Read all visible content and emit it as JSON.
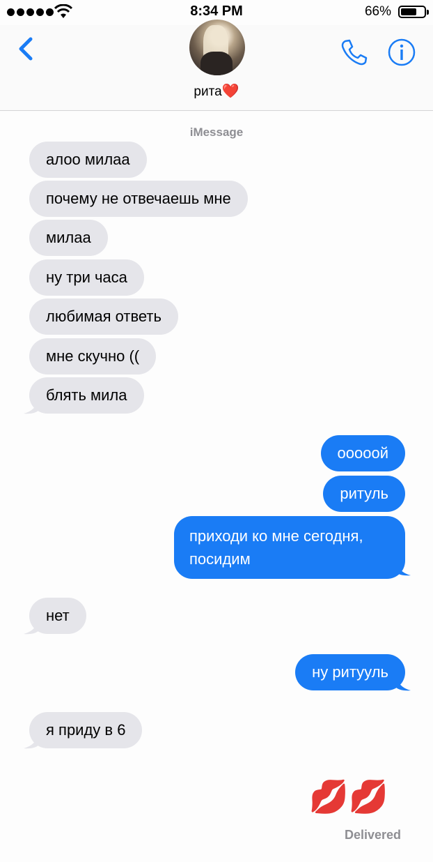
{
  "status_bar": {
    "time": "8:34 PM",
    "battery_percent": "66%",
    "battery_level": 0.66,
    "signal_dots": 5
  },
  "header": {
    "contact_name": "рита",
    "contact_emoji": "❤️",
    "back_icon": "chevron-left-icon",
    "call_icon": "phone-icon",
    "info_icon": "info-icon"
  },
  "conversation": {
    "service_label": "iMessage",
    "messages": [
      {
        "from": "them",
        "text": "алоо милаа"
      },
      {
        "from": "them",
        "text": "почему не отвечаешь мне"
      },
      {
        "from": "them",
        "text": "милаа"
      },
      {
        "from": "them",
        "text": "ну три часа"
      },
      {
        "from": "them",
        "text": "любимая ответь"
      },
      {
        "from": "them",
        "text": "мне скучно (("
      },
      {
        "from": "them",
        "text": "блять мила"
      },
      {
        "from": "me",
        "text": "oooooй"
      },
      {
        "from": "me",
        "text": "ритуль"
      },
      {
        "from": "me",
        "text": "приходи ко мне сегодня, посидим"
      },
      {
        "from": "them",
        "text": "нет"
      },
      {
        "from": "me",
        "text": "ну ритууль"
      },
      {
        "from": "them",
        "text": "я приду в 6"
      },
      {
        "from": "me",
        "text": "💋💋"
      }
    ],
    "delivery_status": "Delivered"
  },
  "colors": {
    "incoming_bubble": "#e5e5ea",
    "outgoing_bubble": "#1a7cf5",
    "accent": "#1a7cf5"
  }
}
